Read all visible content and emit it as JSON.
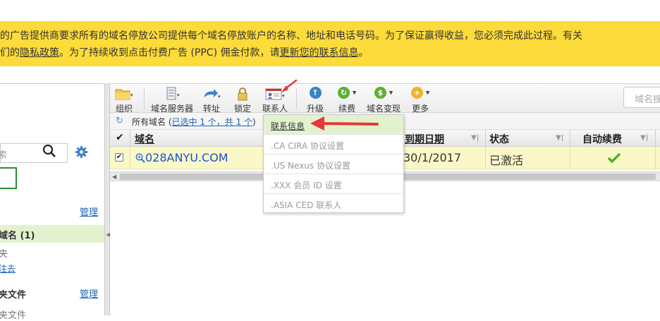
{
  "banner": {
    "line1": "的广告提供商要求所有的域名停放公司提供每个域名停放账户的名称、地址和电话号码。为了保证赢得收益，您必须完成此过程。有关",
    "line2_pre": "们的",
    "line2_link1": "隐私政策",
    "line2_mid": "。为了持续收到点击付费广告 (PPC) 佣金付款，请",
    "line2_link2": "更新您的联系信息",
    "line2_post": "。"
  },
  "toolbar": {
    "items": [
      {
        "label": "组织",
        "icon": "folder-icon"
      },
      {
        "label": "域名服务器",
        "icon": "server-icon"
      },
      {
        "label": "转址",
        "icon": "forward-icon"
      },
      {
        "label": "锁定",
        "icon": "lock-icon"
      },
      {
        "label": "联系人",
        "icon": "contact-card-icon"
      },
      {
        "label": "升级",
        "icon": "upgrade-icon"
      },
      {
        "label": "续费",
        "icon": "renew-icon"
      },
      {
        "label": "域名变现",
        "icon": "cash-icon"
      },
      {
        "label": "更多",
        "icon": "more-icon"
      }
    ],
    "search_placeholder": "域名搜"
  },
  "crumbs": {
    "prefix": "所有域名 (",
    "selected_link": "已选中 1 个，共 1 个",
    "suffix": ")"
  },
  "table": {
    "headers": {
      "check": "✔",
      "domain": "域名",
      "expiry": "到期日期",
      "status": "状态",
      "auto_renew": "自动续费"
    },
    "rows": [
      {
        "domain": "028ANYU.COM",
        "expiry": "30/1/2017",
        "status": "已激活",
        "auto_renew_icon": "check-icon",
        "checked": "✔"
      }
    ]
  },
  "contact_menu": {
    "items": [
      "联系信息",
      ".CA CIRA 协议设置",
      ".US Nexus 协议设置",
      ".XXX 会员 ID 设置",
      ".ASIA CED 联系人"
    ]
  },
  "sidebar": {
    "search_placeholder": "索",
    "manage1": "管理",
    "active_item": "域名 (1)",
    "item_folder": "夹",
    "item_link": "注去",
    "section2": "夹文件",
    "manage2": "管理",
    "item_bottom": "夹文件"
  },
  "colors": {
    "banner": "#fddb3a",
    "link": "#1a62b8",
    "row_highlight": "#fbf8c8",
    "menu_highlight": "#e2f2cf",
    "arrow": "#e53935"
  }
}
